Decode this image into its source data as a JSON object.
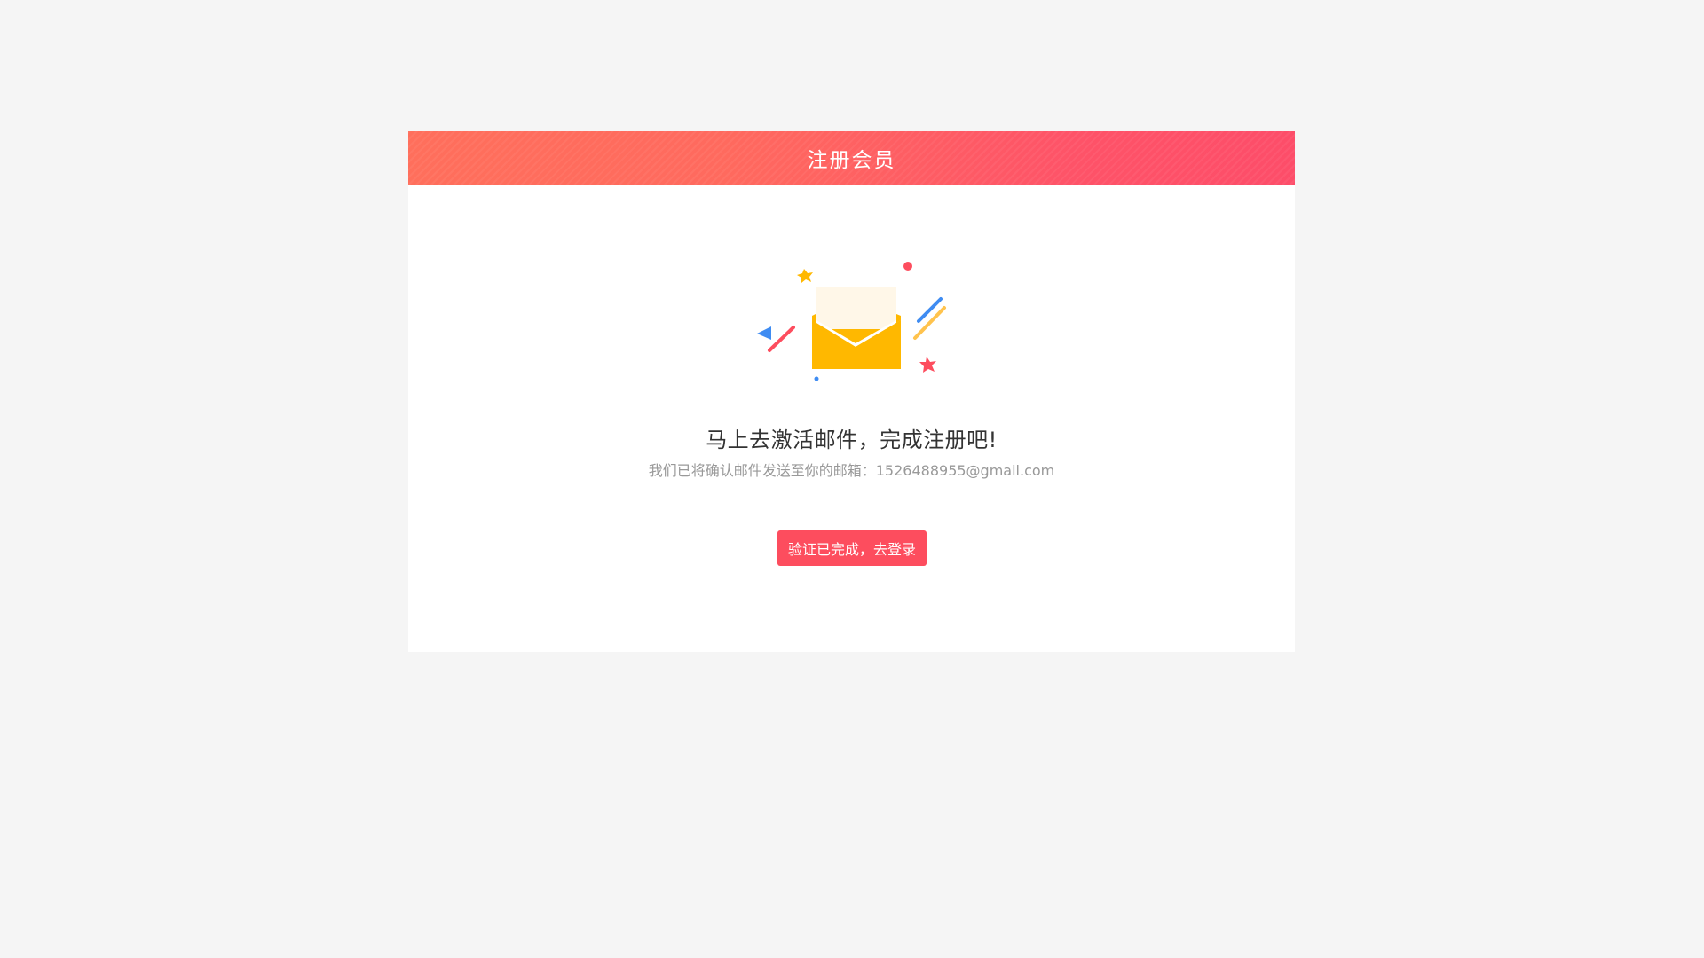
{
  "header": {
    "title": "注册会员"
  },
  "illustration": {
    "icon": "open-envelope-icon"
  },
  "message": {
    "headline": "马上去激活邮件，完成注册吧!",
    "subtext": "我们已将确认邮件发送至你的邮箱：1526488955@gmail.com"
  },
  "actions": {
    "login_label": "验证已完成，去登录"
  },
  "colors": {
    "background": "#f5f5f5",
    "header_start": "#ff6f5c",
    "header_end": "#fd4d69",
    "button": "#fd4d5e",
    "envelope": "#ffb800",
    "letter": "#fff7e8",
    "confetti_blue": "#3f8cf2",
    "confetti_red": "#fd4d5e"
  }
}
